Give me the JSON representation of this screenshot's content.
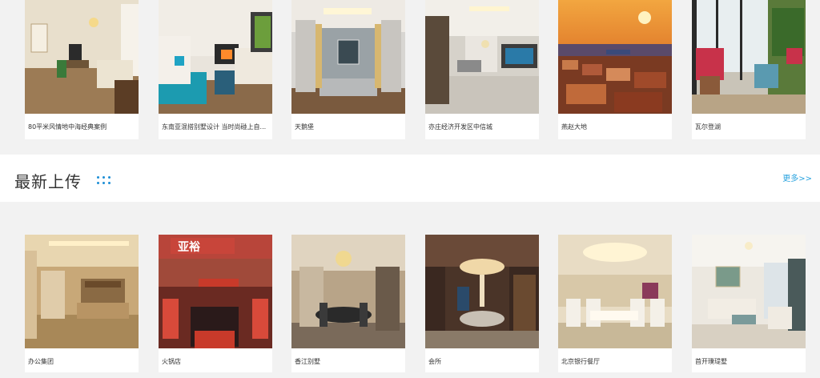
{
  "top_row": [
    {
      "caption": "80平米风情地中海经典案例",
      "image": "living-room-mediterranean"
    },
    {
      "caption": "东南亚混搭别墅设计 当时尚碰上自...",
      "image": "living-room-fireplace"
    },
    {
      "caption": "天鹅堡",
      "image": "living-room-curtains"
    },
    {
      "caption": "亦庄经济开发区中信城",
      "image": "living-room-aquarium"
    },
    {
      "caption": "燕赵大地",
      "image": "city-sunset"
    },
    {
      "caption": "瓦尔登湖",
      "image": "balcony-plants"
    }
  ],
  "section": {
    "title": "最新上传",
    "more_label": "更多>>",
    "accent_color": "#1e8fd6"
  },
  "bottom_row": [
    {
      "caption": "办公集团",
      "image": "office-lobby"
    },
    {
      "caption": "火锅店",
      "image": "hotpot-storefront"
    },
    {
      "caption": "香江别墅",
      "image": "villa-dining"
    },
    {
      "caption": "会所",
      "image": "club-dining-room"
    },
    {
      "caption": "北京银行餐厅",
      "image": "bank-restaurant"
    },
    {
      "caption": "首开璞瑅墅",
      "image": "living-room-white"
    }
  ],
  "storefront_sign": "亚裕"
}
